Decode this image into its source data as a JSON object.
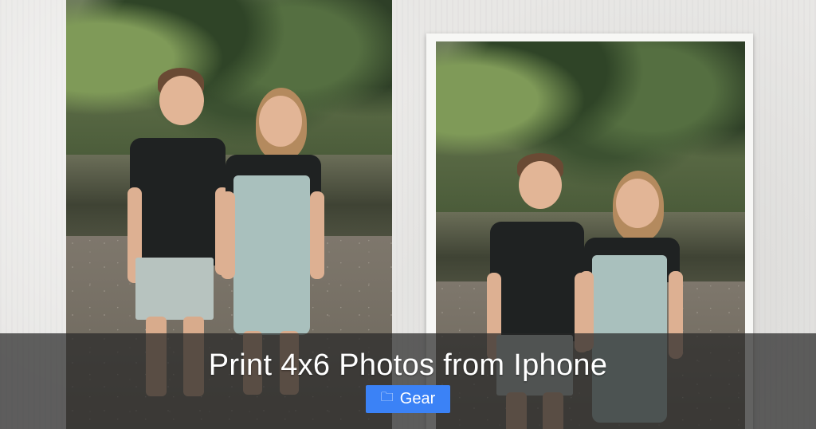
{
  "article": {
    "title": "Print 4x6 Photos from Iphone",
    "category": {
      "label": "Gear",
      "icon": "folder-icon",
      "color": "#3b82f6"
    }
  },
  "images": [
    {
      "name": "photo-left",
      "description": ""
    },
    {
      "name": "photo-right-framed",
      "description": ""
    }
  ]
}
